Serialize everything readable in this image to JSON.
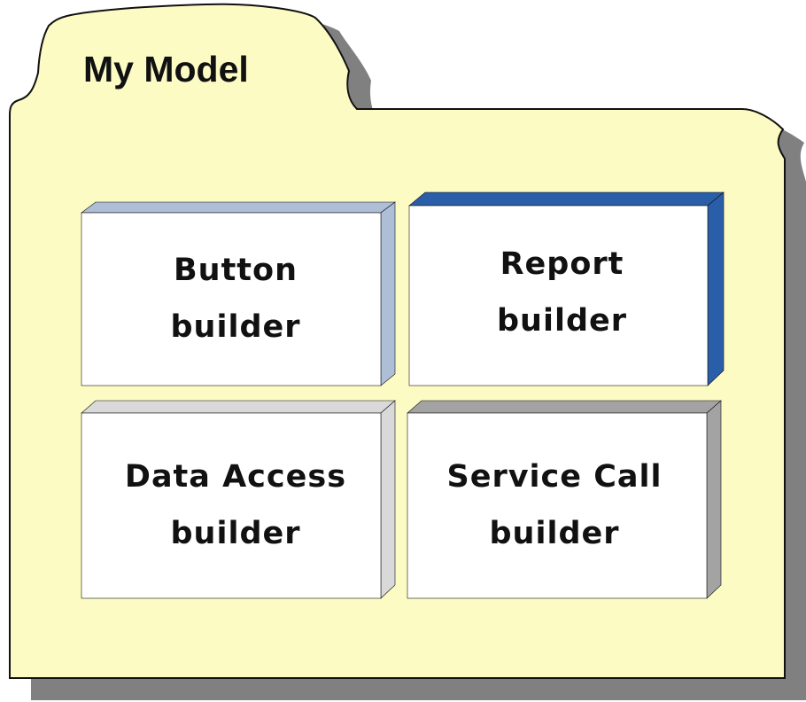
{
  "folder": {
    "title": "My Model"
  },
  "builders": [
    {
      "line1": "Button",
      "line2": "builder"
    },
    {
      "line1": "Report",
      "line2": "builder"
    },
    {
      "line1": "Data Access",
      "line2": "builder"
    },
    {
      "line1": "Service Call",
      "line2": "builder"
    }
  ],
  "colors": {
    "folder_fill": "#fdfbc4",
    "folder_shadow": "#808080",
    "outline": "#111111",
    "box_fill": "#ffffff",
    "button_side": "#aebed6",
    "report_side": "#2b5ea8",
    "data_access_side": "#d9d9d9",
    "service_call_side": "#a3a3a3"
  }
}
